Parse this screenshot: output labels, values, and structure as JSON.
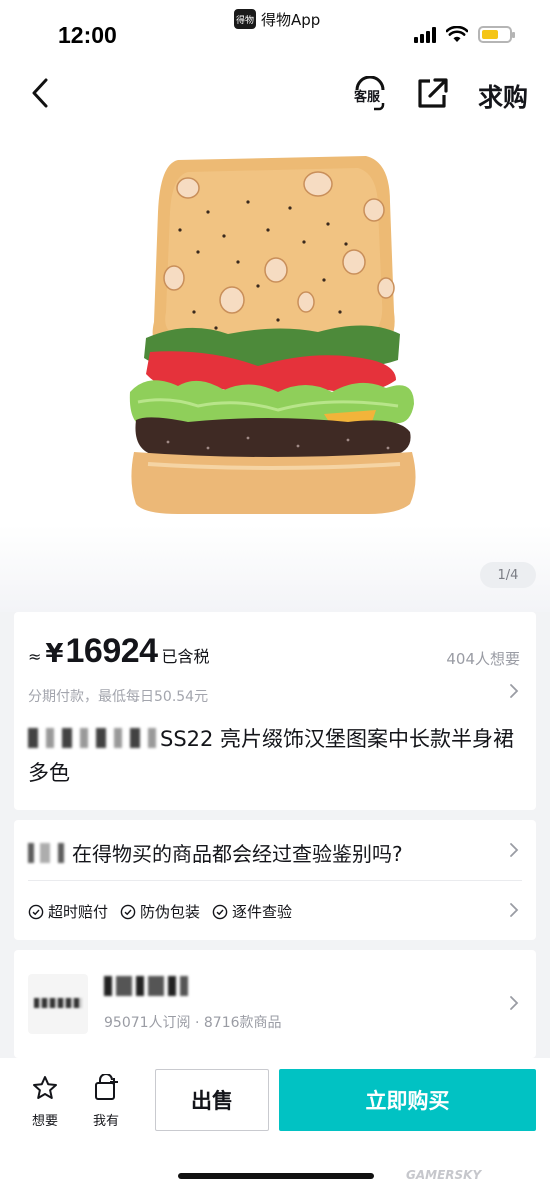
{
  "status_bar": {
    "time": "12:00",
    "app_name": "得物App",
    "app_logo_text": "得物"
  },
  "nav": {
    "service_label": "客服",
    "wanted_label": "求购"
  },
  "gallery": {
    "page_indicator": "1/4"
  },
  "price": {
    "approx": "≈",
    "currency": "¥",
    "value": "16924",
    "tax_note": "已含税",
    "wants": "404人想要",
    "installment": "分期付款，最低每日50.54元"
  },
  "product": {
    "title": "SS22 亮片缀饰汉堡图案中长款半身裙 多色"
  },
  "faq": {
    "question": "在得物买的商品都会经过查验鉴别吗?"
  },
  "assurances": [
    "超时赔付",
    "防伪包装",
    "逐件查验"
  ],
  "shop": {
    "stats": "95071人订阅 · 8716款商品"
  },
  "bottom": {
    "want_label": "想要",
    "own_label": "我有",
    "sell_label": "出售",
    "buy_label": "立即购买"
  },
  "watermark": "GAMERSKY",
  "colors": {
    "accent": "#01c2c3",
    "muted": "#9a9ca4",
    "battery": "#f5c518"
  }
}
